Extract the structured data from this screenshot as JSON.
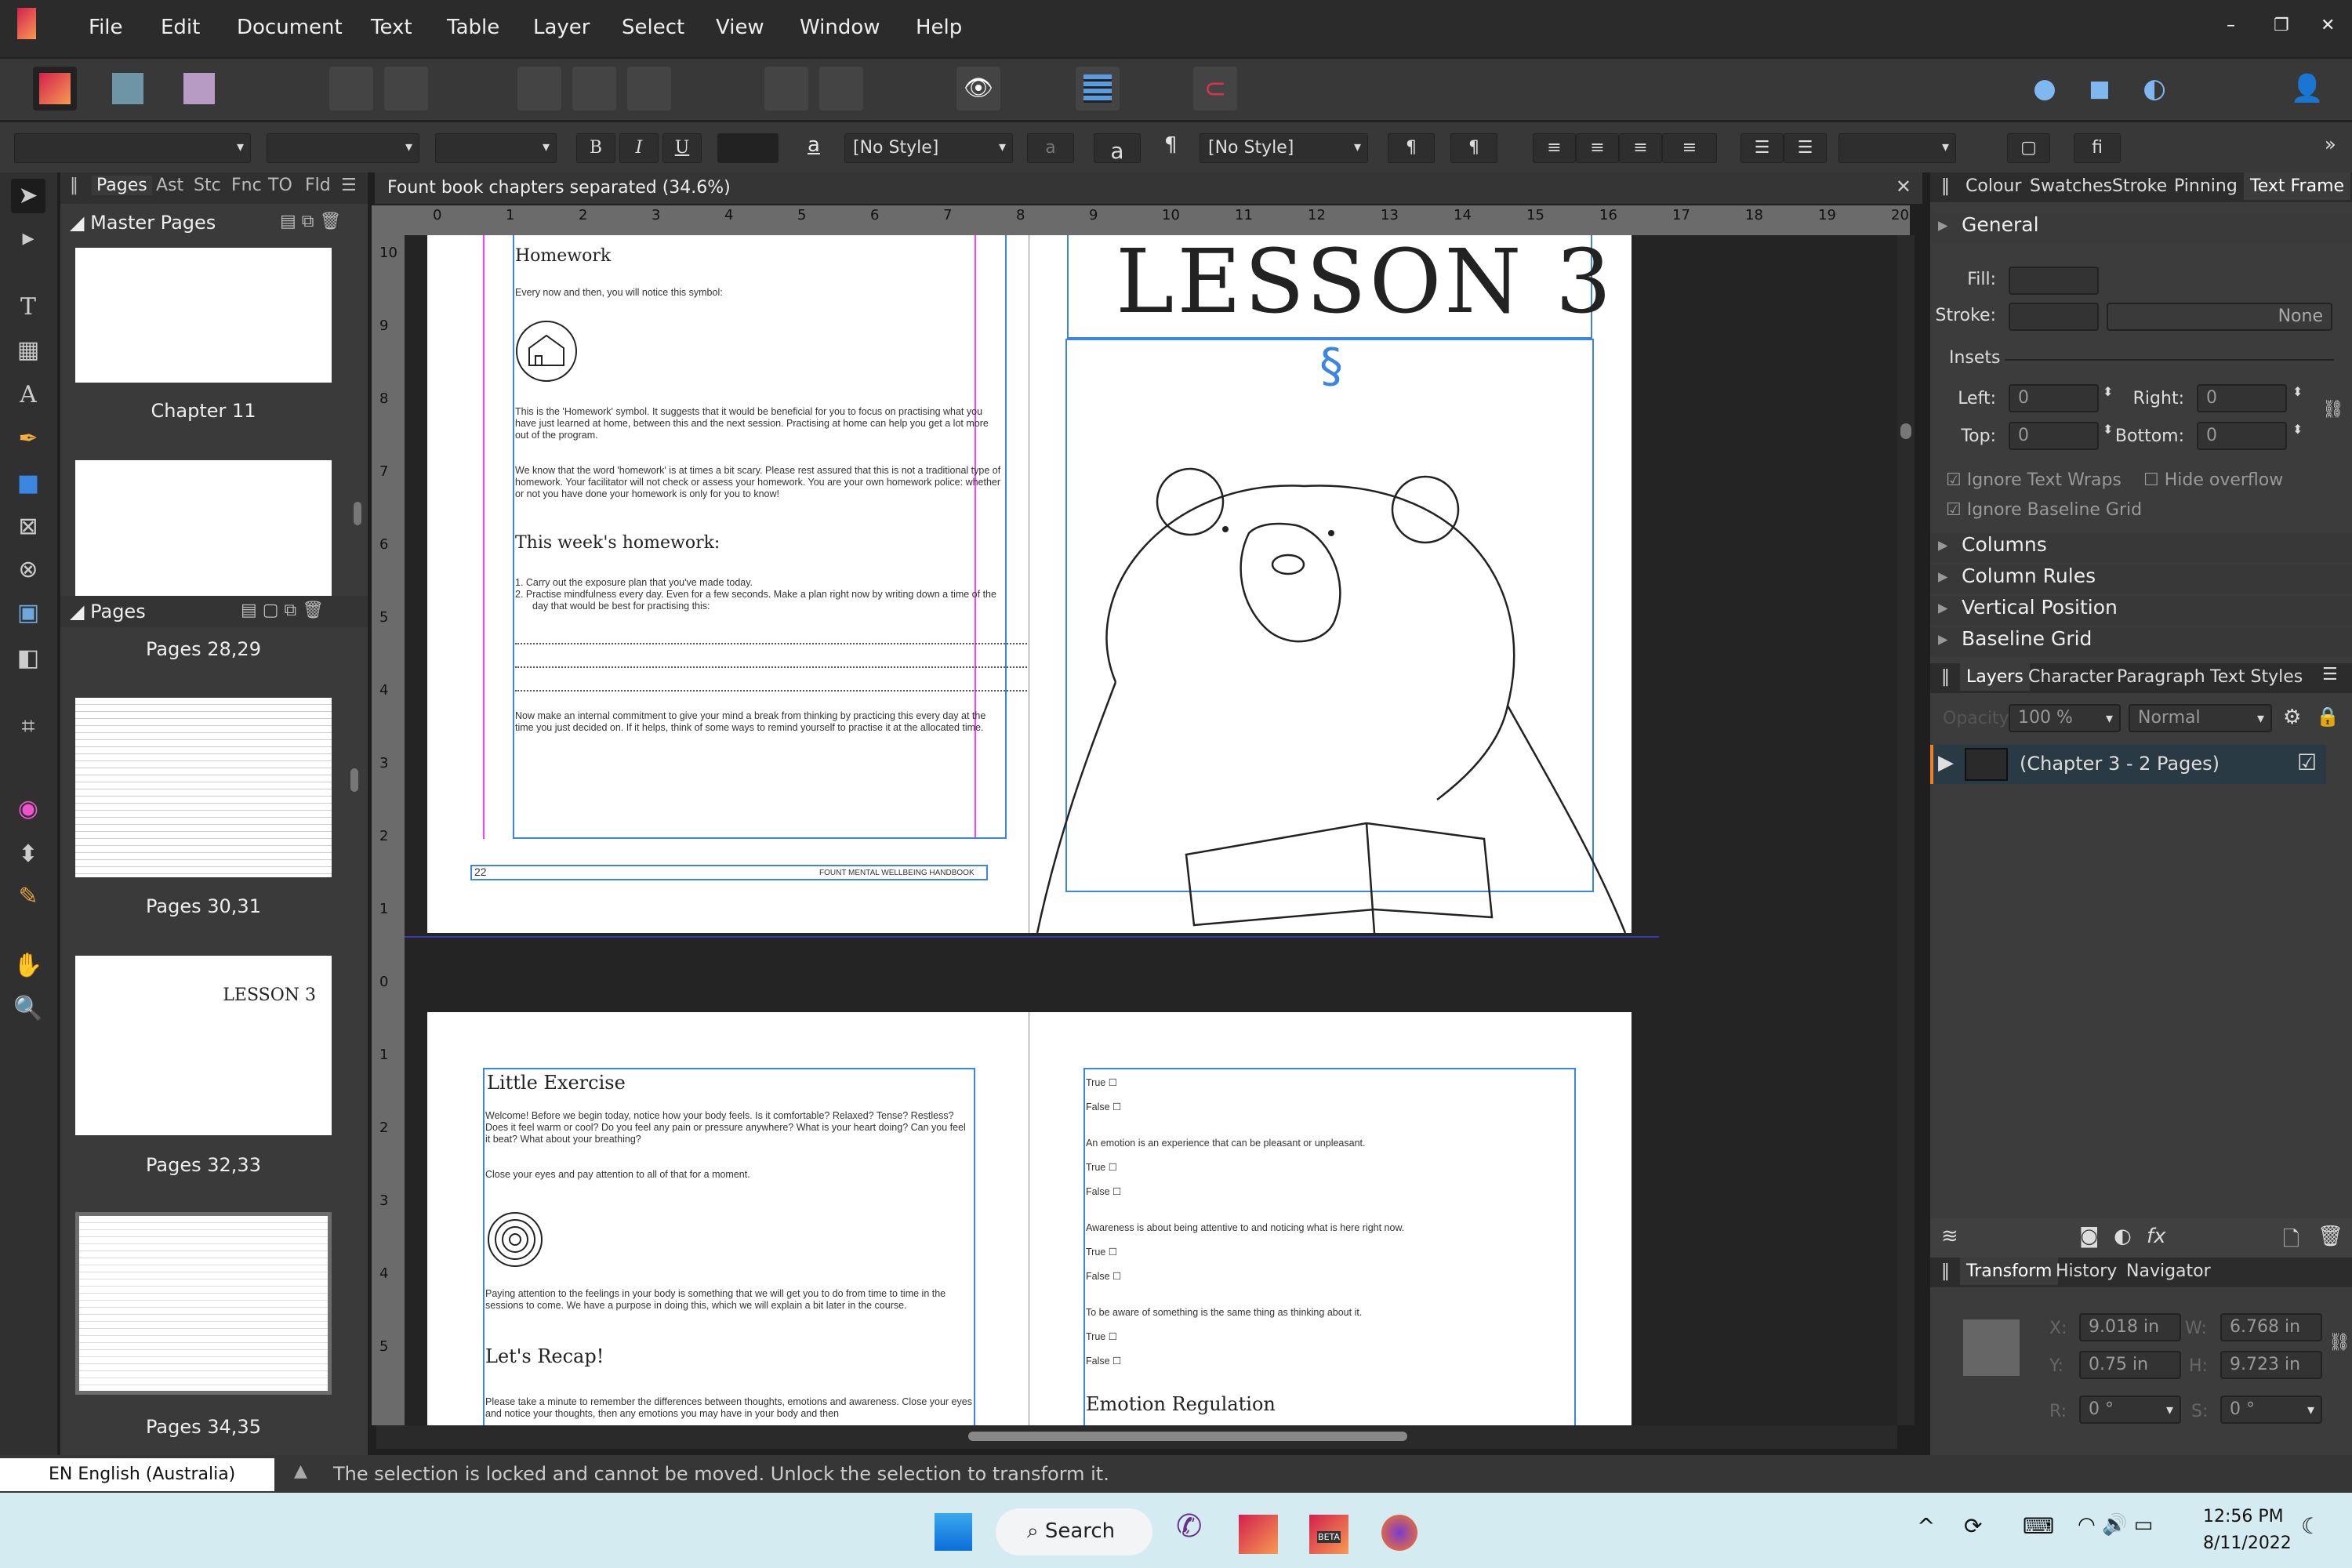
{
  "menu": [
    "File",
    "Edit",
    "Document",
    "Text",
    "Table",
    "Layer",
    "Select",
    "View",
    "Window",
    "Help"
  ],
  "context": {
    "bold": "B",
    "italic": "I",
    "underline": "U",
    "char_style": "[No Style]",
    "para_style": "[No Style]",
    "a1": "a",
    "a2": "a",
    "pilcrow": "¶"
  },
  "pages_panel": {
    "tabs": [
      "Pages",
      "Ast",
      "Stc",
      "Fnc",
      "TO",
      "Fld"
    ],
    "master_header": "Master Pages",
    "master_items": [
      "Chapter 11"
    ],
    "pages_header": "Pages",
    "page_items": [
      "Pages 28,29",
      "Pages 30,31",
      "Pages 32,33",
      "Pages 34,35"
    ]
  },
  "document": {
    "title": "Fount book chapters separated (34.6%)",
    "ruler_unit": "in",
    "h_ticks": [
      "0",
      "1",
      "2",
      "3",
      "4",
      "5",
      "6",
      "7",
      "8",
      "9",
      "10",
      "11",
      "12",
      "13",
      "14",
      "15",
      "16",
      "17",
      "18",
      "19",
      "20"
    ],
    "v_ticks": [
      "10",
      "9",
      "8",
      "7",
      "6",
      "5",
      "4",
      "3",
      "2",
      "1",
      "0",
      "1",
      "2",
      "3",
      "4",
      "5"
    ]
  },
  "spread1": {
    "left": {
      "heading": "Homework",
      "intro": "Every now and then, you will notice this symbol:",
      "p1": "This is the 'Homework' symbol. It suggests that it would be beneficial for you to focus on practising what you have just learned at home, between this and the next session. Practising at home can help you get a lot more out of the program.",
      "p2": "We know that the word 'homework' is at times a bit scary. Please rest assured that this is not a traditional type of homework. Your facilitator will not check or assess your homework. You are your own homework police: whether or not you have done your homework is only for you to know!",
      "subheading": "This week's homework:",
      "list": [
        "1.  Carry out the exposure plan that you've made today.",
        "2.  Practise mindfulness every day. Even for a few seconds. Make a plan right now by writing down a time of the day that would be best for practising this:"
      ],
      "p3": "Now make an internal commitment to give your mind a break from thinking by practicing this every day at the time you just decided on. If it helps, think of some ways to remind yourself to practise it at the allocated time.",
      "page_number": "22",
      "footer": "FOUNT MENTAL WELLBEING HANDBOOK"
    },
    "right": {
      "title": "LESSON 3",
      "section_mark": "§"
    }
  },
  "spread2": {
    "left": {
      "heading": "Little Exercise",
      "p1": "Welcome! Before we begin today, notice how your body feels. Is it comfortable? Relaxed? Tense? Restless? Does it feel warm or cool? Do you feel any pain or pressure anywhere? What is your heart doing? Can you feel it beat? What about your breathing?",
      "p2": "Close your eyes and pay attention to all of that for a moment.",
      "p3": "Paying attention to the feelings in your body is something that we will get you to do from time to time in the sessions to come. We have a purpose in doing this, which we will explain a bit later in the course.",
      "heading2": "Let's Recap!",
      "p4": "Please take a minute to remember the differences between thoughts, emotions and awareness. Close your eyes and notice your thoughts, then any emotions you may have in your body and then"
    },
    "right": {
      "quiz": [
        {
          "q": "",
          "opts": [
            "True",
            "False"
          ]
        },
        {
          "q": "An emotion is an experience that can be pleasant or unpleasant.",
          "opts": [
            "True",
            "False"
          ]
        },
        {
          "q": "Awareness is about being attentive to and noticing what is here right now.",
          "opts": [
            "True",
            "False"
          ]
        },
        {
          "q": "To be aware of something is the same thing as thinking about it.",
          "opts": [
            "True",
            "False"
          ]
        }
      ],
      "heading": "Emotion Regulation"
    }
  },
  "right_panel": {
    "tabs": [
      "Colour",
      "Swatches",
      "Stroke",
      "Pinning",
      "Text Frame"
    ],
    "general": "General",
    "fill_label": "Fill:",
    "stroke_label": "Stroke:",
    "stroke_value": "None",
    "insets": "Insets",
    "left_label": "Left:",
    "left": "0",
    "right_label": "Right:",
    "right": "0",
    "top_label": "Top:",
    "top": "0",
    "bottom_label": "Bottom:",
    "bottom": "0",
    "ignore_wraps": "Ignore Text Wraps",
    "hide_overflow": "Hide overflow",
    "ignore_baseline": "Ignore Baseline Grid",
    "sections": [
      "Columns",
      "Column Rules",
      "Vertical Position",
      "Baseline Grid"
    ],
    "layer_tabs": [
      "Layers",
      "Character",
      "Paragraph",
      "Text Styles"
    ],
    "opacity_label": "Opacity:",
    "opacity": "100 %",
    "blend": "Normal",
    "layer_name": "(Chapter 3 - 2 Pages)",
    "transform_tabs": [
      "Transform",
      "History",
      "Navigator"
    ],
    "x_label": "X:",
    "x": "9.018 in",
    "y_label": "Y:",
    "y": "0.75 in",
    "w_label": "W:",
    "w": "6.768 in",
    "h_label": "H:",
    "h": "9.723 in",
    "r_label": "R:",
    "r": "0 °",
    "s_label": "S:",
    "s": "0 °"
  },
  "status": {
    "language": "EN English (Australia)",
    "message": "The selection is locked and cannot be moved. Unlock the selection to transform it."
  },
  "taskbar": {
    "search": "Search",
    "time": "12:56 PM",
    "date": "8/11/2022",
    "beta": "BETA"
  },
  "colors": {
    "accent": "#3a86e0",
    "margin": "#ff3cff",
    "app_orange": "#f79a52",
    "app_red": "#d3214c"
  }
}
